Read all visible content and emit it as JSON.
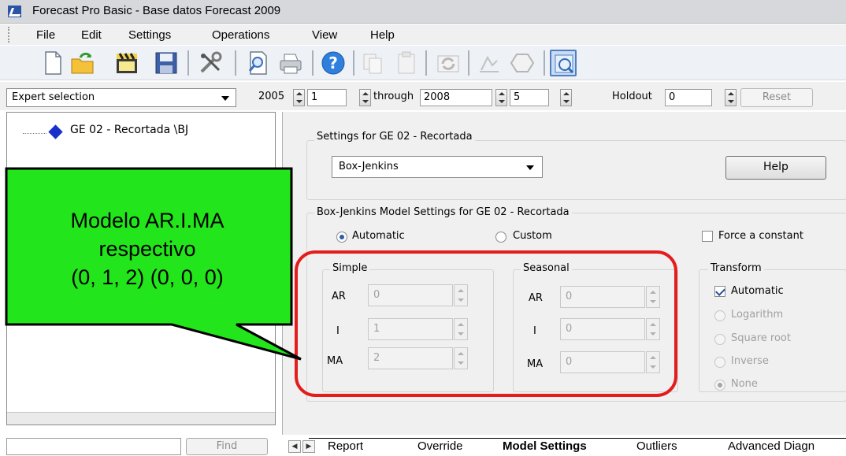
{
  "window": {
    "title": "Forecast Pro Basic - Base datos Forecast 2009"
  },
  "menu": [
    "File",
    "Edit",
    "Settings",
    "Operations",
    "View",
    "Help"
  ],
  "toolbar_icons": [
    "new-file-icon",
    "open-folder-icon",
    "clapperboard-icon",
    "save-icon",
    "tools-icon",
    "search-doc-icon",
    "print-icon",
    "help-icon",
    "copy-icon",
    "paste-icon",
    "refresh-icon",
    "chart-icon",
    "shape-icon",
    "view-icon"
  ],
  "controls": {
    "method": "Expert selection",
    "start_year": "2005",
    "start_period": "1",
    "through_label": "through",
    "end_year": "2008",
    "end_period": "5",
    "holdout_label": "Holdout",
    "holdout_value": "0",
    "reset_label": "Reset"
  },
  "tree": {
    "item": "GE 02 - Recortada \\BJ"
  },
  "find": {
    "button": "Find",
    "value": ""
  },
  "settings": {
    "group_title": "Settings for GE 02 - Recortada",
    "model": "Box-Jenkins",
    "help_button": "Help",
    "bj_group_title": "Box-Jenkins Model Settings for GE 02 - Recortada",
    "automatic": "Automatic",
    "custom": "Custom",
    "force_constant": "Force a constant",
    "simple": {
      "title": "Simple",
      "ar_label": "AR",
      "ar": "0",
      "i_label": "I",
      "i": "1",
      "ma_label": "MA",
      "ma": "2"
    },
    "seasonal": {
      "title": "Seasonal",
      "ar_label": "AR",
      "ar": "0",
      "i_label": "I",
      "i": "0",
      "ma_label": "MA",
      "ma": "0"
    },
    "transform": {
      "title": "Transform",
      "automatic": "Automatic",
      "options": [
        "Logarithm",
        "Square root",
        "Inverse",
        "None"
      ]
    }
  },
  "tabs": [
    "Report",
    "Override",
    "Model Settings",
    "Outliers",
    "Advanced Diagn"
  ],
  "callout": {
    "lines": [
      "Modelo AR.I.MA",
      "respectivo",
      "(0, 1, 2) (0, 0, 0)"
    ],
    "fill": "#22e51b"
  },
  "colors": {
    "highlight": "#e31c1c"
  }
}
